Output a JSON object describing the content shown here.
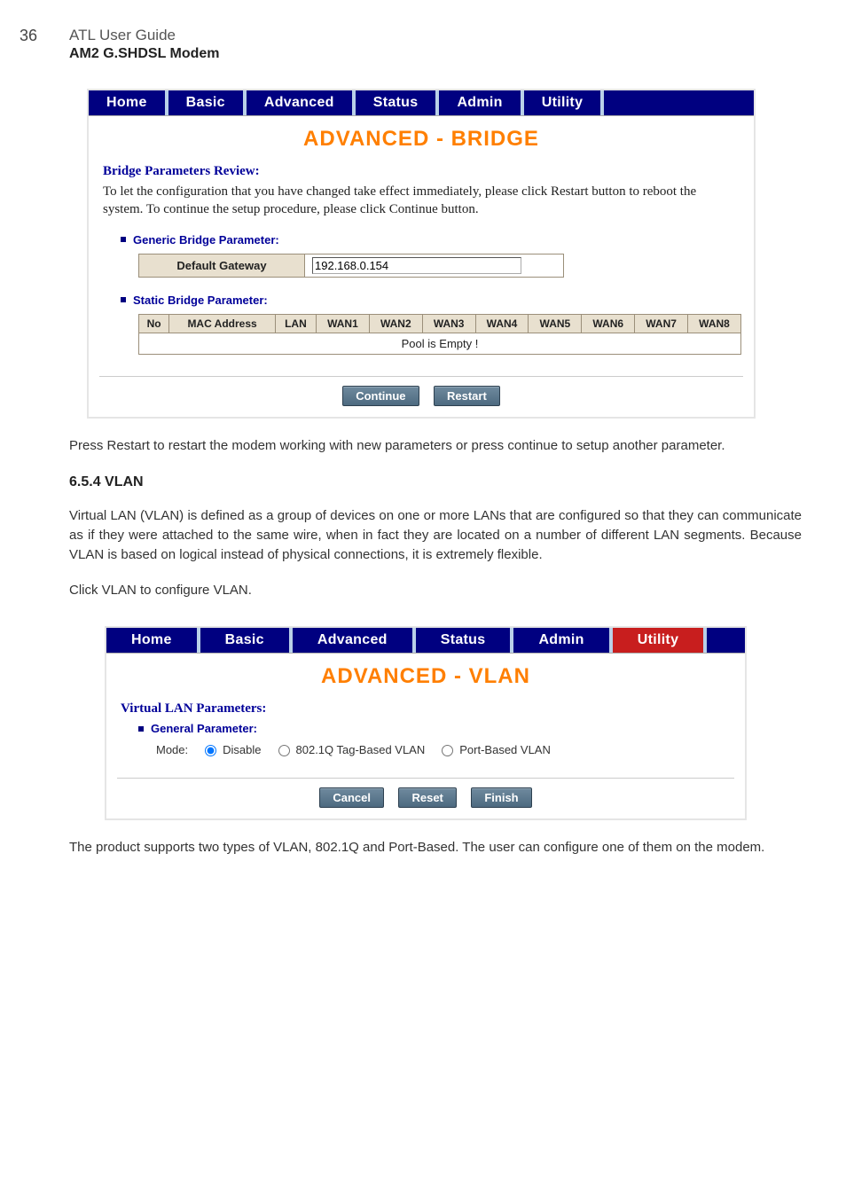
{
  "page": {
    "number": "36",
    "header1": "ATL User Guide",
    "header2": "AM2 G.SHDSL Modem"
  },
  "tabs": [
    "Home",
    "Basic",
    "Advanced",
    "Status",
    "Admin",
    "Utility"
  ],
  "bridge": {
    "title": "ADVANCED - BRIDGE",
    "subhead": "Bridge Parameters Review:",
    "desc": "To let the configuration that you have changed take effect immediately,  please click Restart button to reboot the system.  To continue the setup procedure, please click Continue button.",
    "generic_label": "Generic Bridge Parameter:",
    "default_gateway_label": "Default Gateway",
    "default_gateway_value": "192.168.0.154",
    "static_label": "Static Bridge Parameter:",
    "columns": [
      "No",
      "MAC Address",
      "LAN",
      "WAN1",
      "WAN2",
      "WAN3",
      "WAN4",
      "WAN5",
      "WAN6",
      "WAN7",
      "WAN8"
    ],
    "pool_empty": "Pool is Empty !",
    "btn_continue": "Continue",
    "btn_restart": "Restart"
  },
  "body": {
    "para1": "Press Restart to restart the modem working with new parameters or press continue to setup another parameter.",
    "section_head": "6.5.4   VLAN",
    "para2": "Virtual LAN (VLAN) is defined as a group of devices on one or more LANs that are configured so that they can communicate as if they were attached to the same wire, when in fact they are located on a number of different LAN segments. Because VLAN is based on logical instead of physical connections, it is extremely flexible.",
    "para3": "Click VLAN to configure VLAN."
  },
  "vlan": {
    "title": "ADVANCED - VLAN",
    "subhead": "Virtual LAN Parameters:",
    "general_label": "General Parameter:",
    "mode_label": "Mode:",
    "opt_disable": "Disable",
    "opt_tag": "802.1Q Tag-Based VLAN",
    "opt_port": "Port-Based VLAN",
    "btn_cancel": "Cancel",
    "btn_reset": "Reset",
    "btn_finish": "Finish"
  },
  "footer": {
    "para": "The product supports two types of VLAN, 802.1Q and Port-Based. The user can configure one of them on the modem."
  }
}
